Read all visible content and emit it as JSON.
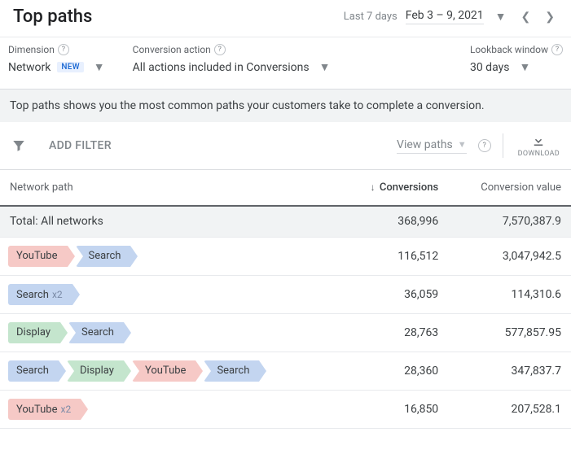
{
  "header": {
    "title": "Top paths",
    "date_last_label": "Last 7 days",
    "date_range": "Feb 3 – 9, 2021"
  },
  "filters": {
    "dimension": {
      "label": "Dimension",
      "value": "Network",
      "badge": "NEW"
    },
    "conversion_action": {
      "label": "Conversion action",
      "value": "All actions included in Conversions"
    },
    "lookback": {
      "label": "Lookback window",
      "value": "30 days"
    }
  },
  "description": "Top paths shows you the most common paths your customers take to complete a conversion.",
  "toolbar": {
    "add_filter": "ADD FILTER",
    "view_paths": "View paths",
    "download": "DOWNLOAD"
  },
  "table": {
    "columns": {
      "path": "Network path",
      "conversions": "Conversions",
      "value": "Conversion value"
    },
    "total_label": "Total: All networks",
    "total_conversions": "368,996",
    "total_value": "7,570,387.9",
    "rows": [
      {
        "path": [
          {
            "name": "YouTube",
            "kind": "youtube"
          },
          {
            "name": "Search",
            "kind": "search"
          }
        ],
        "conversions": "116,512",
        "value": "3,047,942.5"
      },
      {
        "path": [
          {
            "name": "Search",
            "kind": "search",
            "mult": "x2"
          }
        ],
        "conversions": "36,059",
        "value": "114,310.6"
      },
      {
        "path": [
          {
            "name": "Display",
            "kind": "display"
          },
          {
            "name": "Search",
            "kind": "search"
          }
        ],
        "conversions": "28,763",
        "value": "577,857.95"
      },
      {
        "path": [
          {
            "name": "Search",
            "kind": "search"
          },
          {
            "name": "Display",
            "kind": "display"
          },
          {
            "name": "YouTube",
            "kind": "youtube"
          },
          {
            "name": "Search",
            "kind": "search"
          }
        ],
        "conversions": "28,360",
        "value": "347,837.7"
      },
      {
        "path": [
          {
            "name": "YouTube",
            "kind": "youtube",
            "mult": "x2"
          }
        ],
        "conversions": "16,850",
        "value": "207,528.1"
      }
    ]
  }
}
